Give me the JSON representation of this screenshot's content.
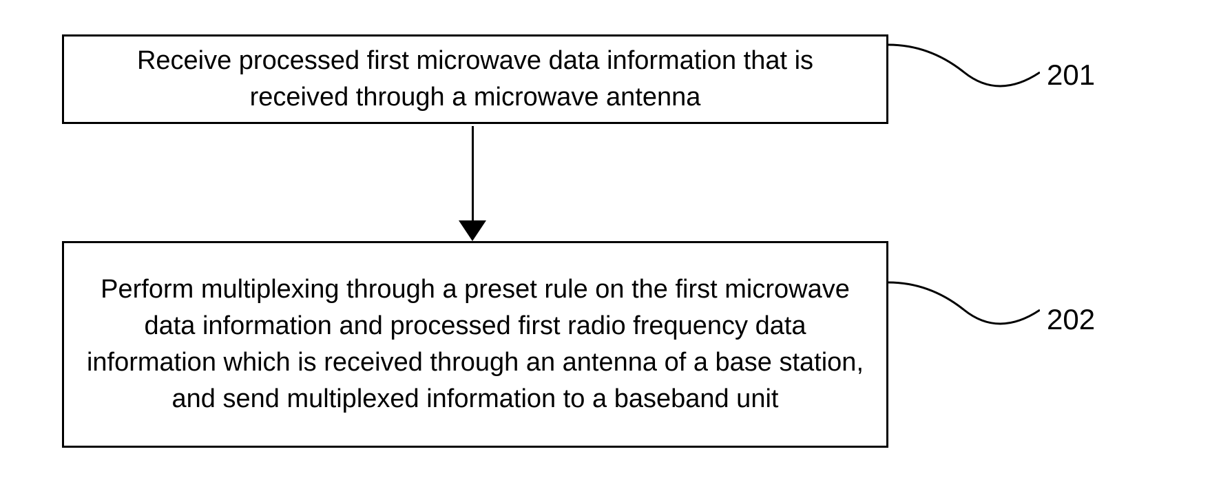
{
  "box1": {
    "text": "Receive processed first microwave data information that is received through a microwave antenna",
    "label": "201"
  },
  "box2": {
    "text": "Perform multiplexing through a preset rule on the first microwave data information and processed first radio frequency data information which is received through an antenna of a base station, and send multiplexed information to a baseband unit",
    "label": "202"
  }
}
